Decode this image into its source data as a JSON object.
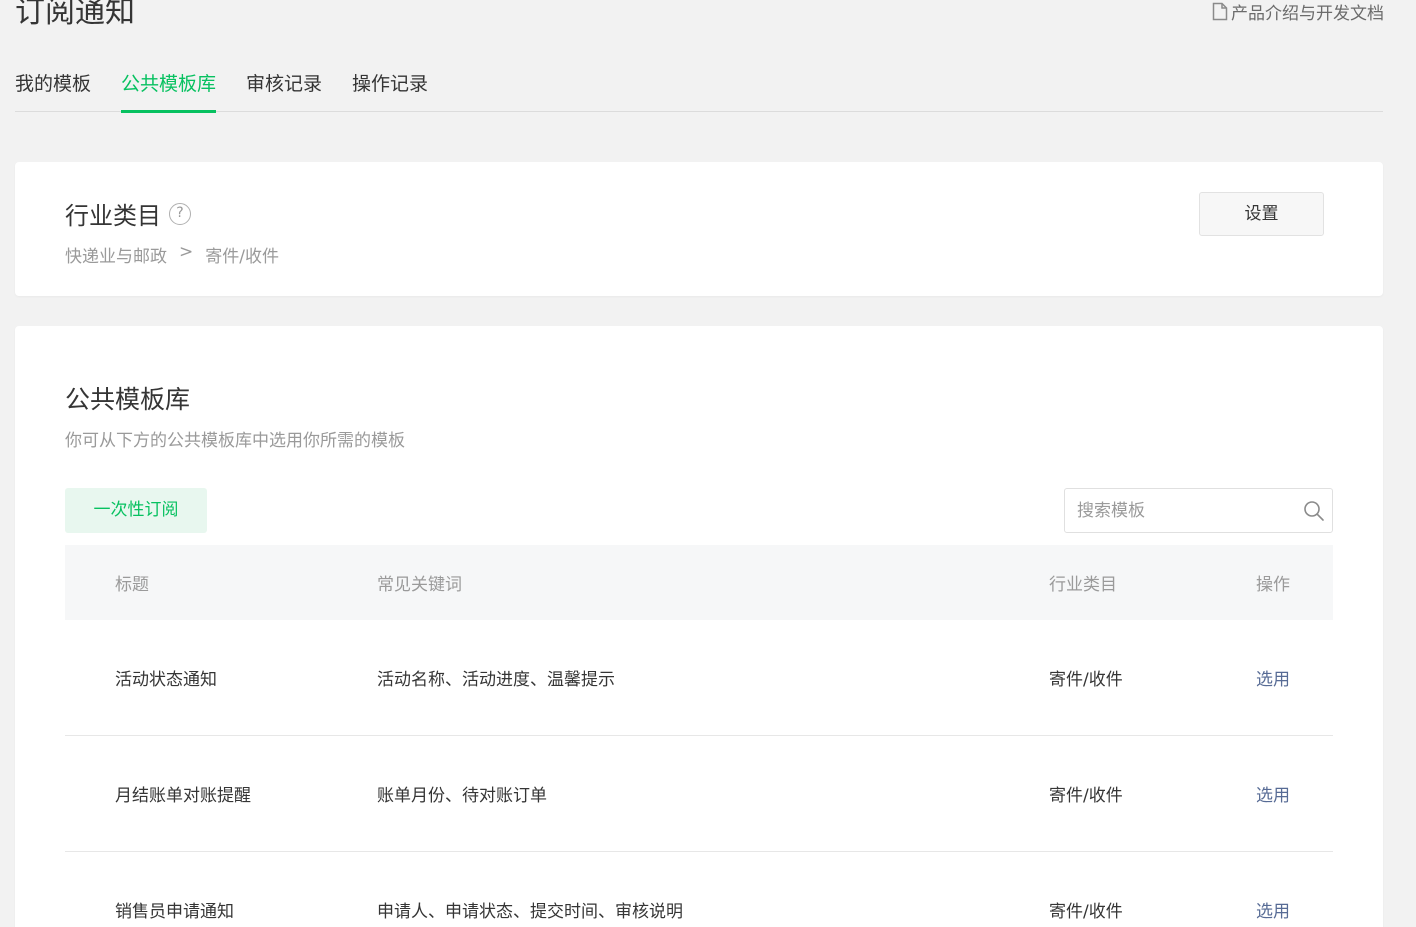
{
  "page": {
    "title": "订阅通知",
    "doc_link": "产品介绍与开发文档"
  },
  "tabs": [
    {
      "label": "我的模板",
      "active": false
    },
    {
      "label": "公共模板库",
      "active": true
    },
    {
      "label": "审核记录",
      "active": false
    },
    {
      "label": "操作记录",
      "active": false
    }
  ],
  "industry": {
    "title": "行业类目",
    "help": "?",
    "path": [
      "快递业与邮政",
      ">",
      "寄件/收件"
    ],
    "settings_button": "设置"
  },
  "library": {
    "title": "公共模板库",
    "description": "你可从下方的公共模板库中选用你所需的模板",
    "filter_tag": "一次性订阅",
    "search_placeholder": "搜索模板",
    "columns": [
      "标题",
      "常见关键词",
      "行业类目",
      "操作"
    ],
    "rows": [
      {
        "title": "活动状态通知",
        "keywords": "活动名称、活动进度、温馨提示",
        "category": "寄件/收件",
        "action": "选用"
      },
      {
        "title": "月结账单对账提醒",
        "keywords": "账单月份、待对账订单",
        "category": "寄件/收件",
        "action": "选用"
      },
      {
        "title": "销售员申请通知",
        "keywords": "申请人、申请状态、提交时间、审核说明",
        "category": "寄件/收件",
        "action": "选用"
      }
    ]
  },
  "colors": {
    "accent": "#07c160",
    "link": "#576b95",
    "background": "#f2f2f2"
  }
}
